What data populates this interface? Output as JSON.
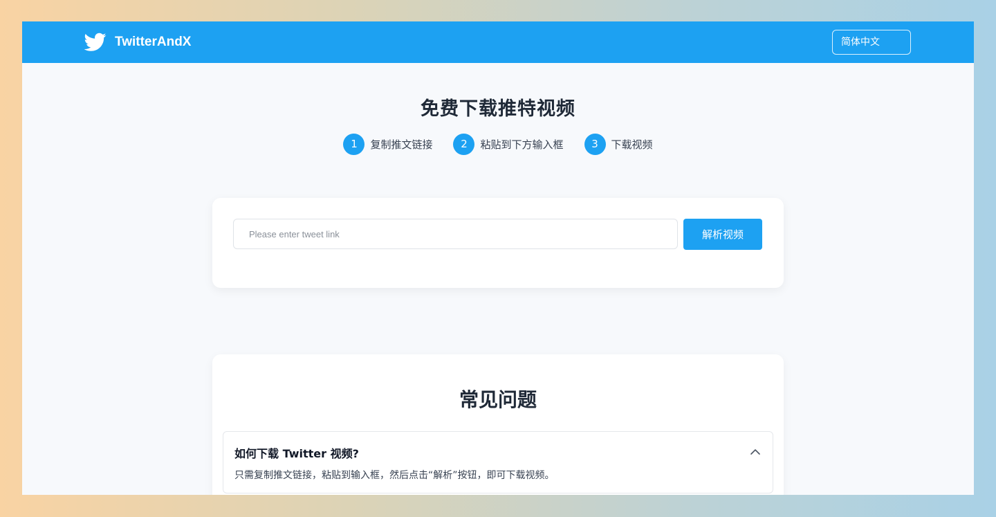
{
  "header": {
    "brand_name": "TwitterAndX",
    "brand_icon": "twitter-bird-icon",
    "language_label": "简体中文",
    "bg_color": "#1da1f2"
  },
  "hero": {
    "title": "免费下载推特视频",
    "steps": [
      {
        "number": "1",
        "label": "复制推文链接"
      },
      {
        "number": "2",
        "label": "粘贴到下方输入框"
      },
      {
        "number": "3",
        "label": "下载视频"
      }
    ]
  },
  "search": {
    "placeholder": "Please enter tweet link",
    "value": "",
    "button_label": "解析视频"
  },
  "faq": {
    "title": "常见问题",
    "items": [
      {
        "question": "如何下载 Twitter 视频?",
        "answer": "只需复制推文链接，粘贴到输入框，然后点击“解析”按钮，即可下载视频。",
        "expanded": true,
        "toggle_icon": "chevron-up-icon"
      }
    ]
  },
  "colors": {
    "accent": "#1da1f2",
    "page_bg": "#f7f9fc"
  }
}
